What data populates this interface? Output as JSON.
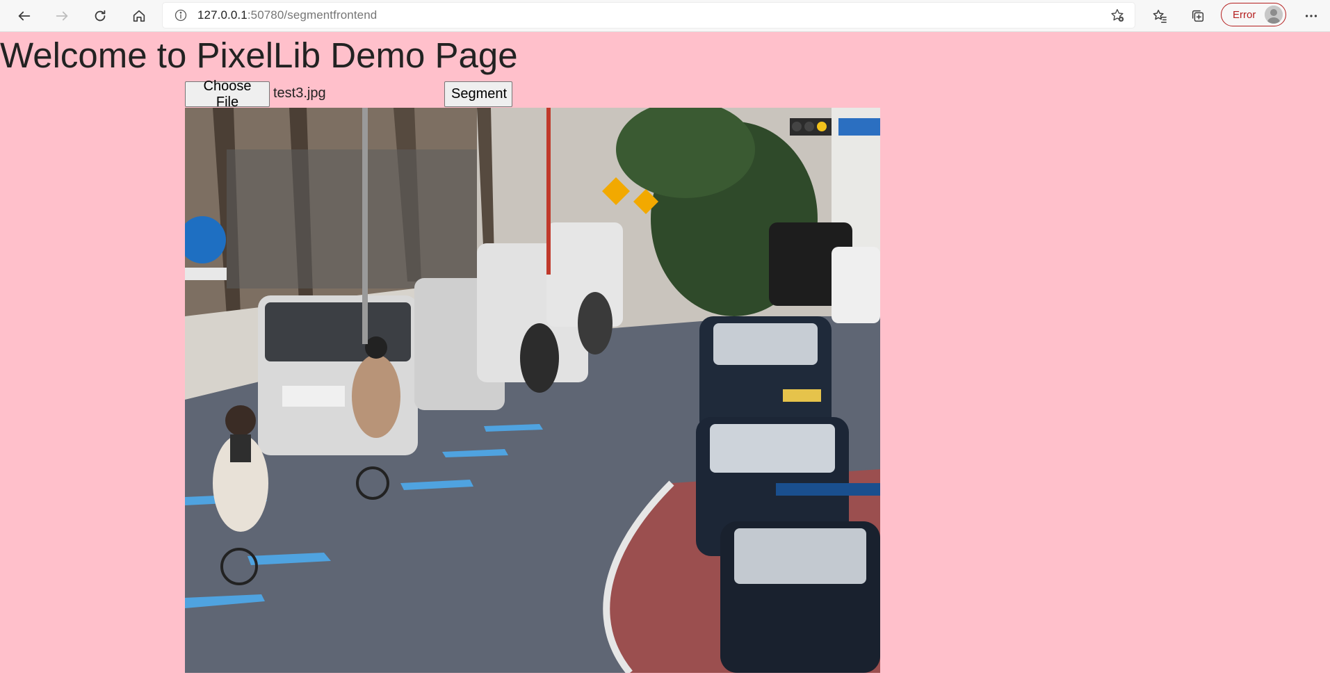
{
  "browser": {
    "url_host": "127.0.0.1",
    "url_rest": ":50780/segmentfrontend",
    "profile_status": "Error",
    "icons": {
      "back": "back-arrow-icon",
      "forward": "forward-arrow-icon",
      "reload": "reload-icon",
      "home": "home-icon",
      "site_info": "info-icon",
      "add_favorite": "star-plus-icon",
      "favorites": "favorites-icon",
      "collections": "collections-icon",
      "menu": "more-dots-icon"
    }
  },
  "page": {
    "background": "#ffc0cb",
    "title": "Welcome to PixelLib Demo Page",
    "choose_file_label": "Choose File",
    "selected_file": "test3.jpg",
    "segment_label": "Segment",
    "image_description_icon": "street-photo"
  }
}
